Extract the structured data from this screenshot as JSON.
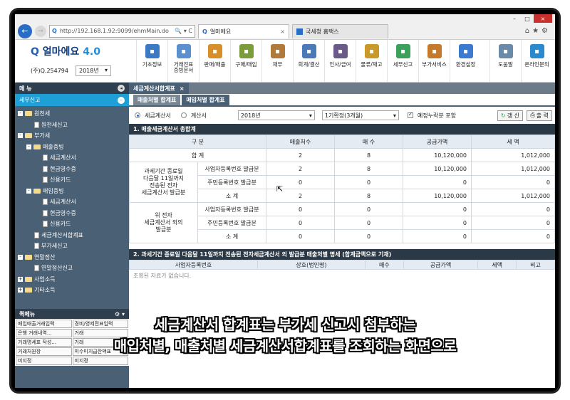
{
  "browser": {
    "url": "http://192.168.1.92:9099/ehmMain.do",
    "url_controls": "🔍 ▾ C",
    "tabs": [
      {
        "label": "얼마에요",
        "close": "×"
      },
      {
        "label": "국세청 홈택스"
      }
    ],
    "win_controls": {
      "minimize": "–",
      "maximize": "□",
      "close": "×"
    },
    "right_icons": "⌂★⚙"
  },
  "app": {
    "logo_text": "얼마에요",
    "logo_version": "4.0",
    "company": "(주)Q.254794",
    "year": "2018년",
    "menu": [
      {
        "label": "기초정보",
        "icon": "ledger-icon",
        "color": "#3b79c4"
      },
      {
        "label": "거래전표\n증빙문서",
        "icon": "voucher-icon",
        "color": "#5a8fd0"
      },
      {
        "label": "판매/매출",
        "icon": "sales-icon",
        "color": "#d88f2a"
      },
      {
        "label": "구매/매입",
        "icon": "purchase-icon",
        "color": "#7b9c3a"
      },
      {
        "label": "재무",
        "icon": "money-bag-icon",
        "color": "#b07a3a"
      },
      {
        "label": "회계/결산",
        "icon": "accounting-icon",
        "color": "#4a7ab8"
      },
      {
        "label": "인사/급여",
        "icon": "person-icon",
        "color": "#6a5a8a"
      },
      {
        "label": "물류/재고",
        "icon": "truck-icon",
        "color": "#c99a2a"
      },
      {
        "label": "세무신고",
        "icon": "tax-icon",
        "color": "#3aa05a"
      },
      {
        "label": "부가서비스",
        "icon": "building-icon",
        "color": "#c47a2a"
      },
      {
        "label": "환경설정",
        "icon": "gear-icon",
        "color": "#3a7ad0"
      },
      {
        "label": "도움말",
        "icon": "help-icon",
        "color": "#6a8aaa"
      },
      {
        "label": "온라인문의",
        "icon": "chat-icon",
        "color": "#2a8ad0"
      }
    ]
  },
  "sidebar": {
    "title": "메 뉴",
    "section": "세무신고",
    "collapse": "◂",
    "tree": [
      {
        "label": "원천세",
        "level": 0,
        "type": "folder",
        "expand": "-"
      },
      {
        "label": "원천세신고",
        "level": 1,
        "type": "doc"
      },
      {
        "label": "부가세",
        "level": 0,
        "type": "folder",
        "expand": "-"
      },
      {
        "label": "매출증빙",
        "level": 1,
        "type": "folder",
        "expand": "-"
      },
      {
        "label": "세금계산서",
        "level": 2,
        "type": "doc"
      },
      {
        "label": "현금영수증",
        "level": 2,
        "type": "doc"
      },
      {
        "label": "신용카드",
        "level": 2,
        "type": "doc"
      },
      {
        "label": "매입증빙",
        "level": 1,
        "type": "folder",
        "expand": "-"
      },
      {
        "label": "세금계산서",
        "level": 2,
        "type": "doc"
      },
      {
        "label": "현금영수증",
        "level": 2,
        "type": "doc"
      },
      {
        "label": "신용카드",
        "level": 2,
        "type": "doc"
      },
      {
        "label": "세금계산서합계표",
        "level": 1,
        "type": "doc"
      },
      {
        "label": "부가세신고",
        "level": 1,
        "type": "doc"
      },
      {
        "label": "연말정산",
        "level": 0,
        "type": "folder",
        "expand": "-"
      },
      {
        "label": "연말정산신고",
        "level": 1,
        "type": "doc"
      },
      {
        "label": "사업소득",
        "level": 0,
        "type": "folder",
        "expand": "+"
      },
      {
        "label": "기타소득",
        "level": 0,
        "type": "folder",
        "expand": "+"
      }
    ],
    "quick_title": "퀵메뉴",
    "quick_icons": "⚙ ▾",
    "quick_items": [
      "매입매출거래입력",
      "경비/영제전표입력",
      "은행 거래내역...",
      "거래",
      "거래명세표 작성...",
      "거래",
      "거래처원장",
      "미수미지급잔액표",
      "미지정",
      "미지정"
    ]
  },
  "content": {
    "tab": "세금계산서합계표",
    "tab_close": "×",
    "subtabs": [
      "매출처별 합계표",
      "매입처별 합계표"
    ],
    "filter": {
      "radio1": "세금계산서",
      "radio2": "계산서",
      "year": "2018년",
      "period": "1기확정(3개월)",
      "checkbox": "예정누락분 포함",
      "refresh": "갱 신",
      "print": "출 력"
    },
    "section1": "1. 매출세금계산서 총합계",
    "table_headers": [
      "구 분",
      "매출처수",
      "매 수",
      "공급가액",
      "세 액"
    ],
    "total_row": {
      "label": "합 계",
      "vendors": "2",
      "count": "8",
      "supply": "10,120,000",
      "tax": "1,012,000"
    },
    "group1_label": "과세기간 종료일\n다음달 11일까지\n전송된 전자\n세금계산서 발급분",
    "group1_rows": [
      {
        "label": "사업자등록번호 발급분",
        "vendors": "2",
        "count": "8",
        "supply": "10,120,000",
        "tax": "1,012,000"
      },
      {
        "label": "주민등록번호 발급분",
        "vendors": "0",
        "count": "0",
        "supply": "0",
        "tax": "0"
      },
      {
        "label": "소 계",
        "vendors": "2",
        "count": "8",
        "supply": "10,120,000",
        "tax": "1,012,000"
      }
    ],
    "group2_label": "위 전자\n세금계산서 외의\n발급분",
    "group2_rows": [
      {
        "label": "사업자등록번호 발급분",
        "vendors": "0",
        "count": "0",
        "supply": "0",
        "tax": "0"
      },
      {
        "label": "주민등록번호 발급분",
        "vendors": "0",
        "count": "0",
        "supply": "0",
        "tax": "0"
      },
      {
        "label": "소 계",
        "vendors": "0",
        "count": "0",
        "supply": "0",
        "tax": "0"
      }
    ],
    "section2": "2. 과세기간 종료일 다음달 11일까지 전송된 전자세금계산서 외 발급분 매출처별 명세 (합계금액으로 기재)",
    "table2_headers": [
      "사업자등록번호",
      "상호(법인명)",
      "매수",
      "공급가액",
      "세액",
      "비고"
    ],
    "empty_text": "조회된 자료가 없습니다."
  },
  "caption": {
    "line1": "세금계산서 합계표는 부가세 신고시 첨부하는",
    "line2": "매입처별, 매출처별 세금계산서합계표를 조회하는 화면으로"
  }
}
